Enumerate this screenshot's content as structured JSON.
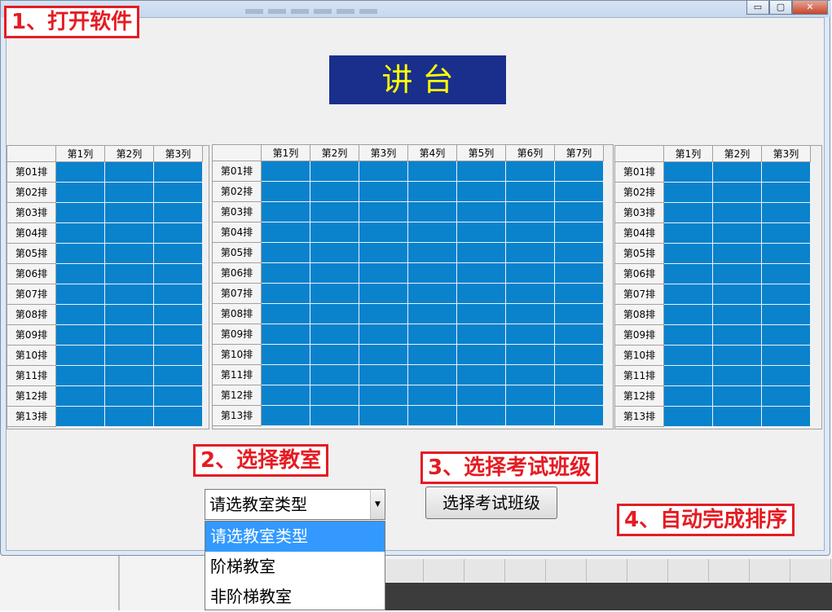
{
  "window": {
    "controls": [
      "▭",
      "▢",
      "✕"
    ]
  },
  "podium": {
    "label": "讲    台"
  },
  "grids": [
    {
      "name": "left",
      "columns": [
        "第1列",
        "第2列",
        "第3列"
      ],
      "rows": [
        "第01排",
        "第02排",
        "第03排",
        "第04排",
        "第05排",
        "第06排",
        "第07排",
        "第08排",
        "第09排",
        "第10排",
        "第11排",
        "第12排",
        "第13排"
      ]
    },
    {
      "name": "middle",
      "columns": [
        "第1列",
        "第2列",
        "第3列",
        "第4列",
        "第5列",
        "第6列",
        "第7列"
      ],
      "rows": [
        "第01排",
        "第02排",
        "第03排",
        "第04排",
        "第05排",
        "第06排",
        "第07排",
        "第08排",
        "第09排",
        "第10排",
        "第11排",
        "第12排",
        "第13排"
      ]
    },
    {
      "name": "right",
      "columns": [
        "第1列",
        "第2列",
        "第3列"
      ],
      "rows": [
        "第01排",
        "第02排",
        "第03排",
        "第04排",
        "第05排",
        "第06排",
        "第07排",
        "第08排",
        "第09排",
        "第10排",
        "第11排",
        "第12排",
        "第13排"
      ]
    }
  ],
  "classroom_combo": {
    "value": "请选教室类型",
    "options": [
      "请选教室类型",
      "阶梯教室",
      "非阶梯教室"
    ],
    "selected_index": 0
  },
  "select_class_button": {
    "label": "选择考试班级"
  },
  "annotations": {
    "step1": "1、打开软件",
    "step2": "2、选择教室",
    "step3": "3、选择考试班级",
    "step4": "4、自动完成排序"
  },
  "colors": {
    "seat": "#0a82cc",
    "podium_bg": "#1a2f8c",
    "podium_text": "#ffff00",
    "annotation": "#e51c23",
    "selection": "#3399ff"
  }
}
